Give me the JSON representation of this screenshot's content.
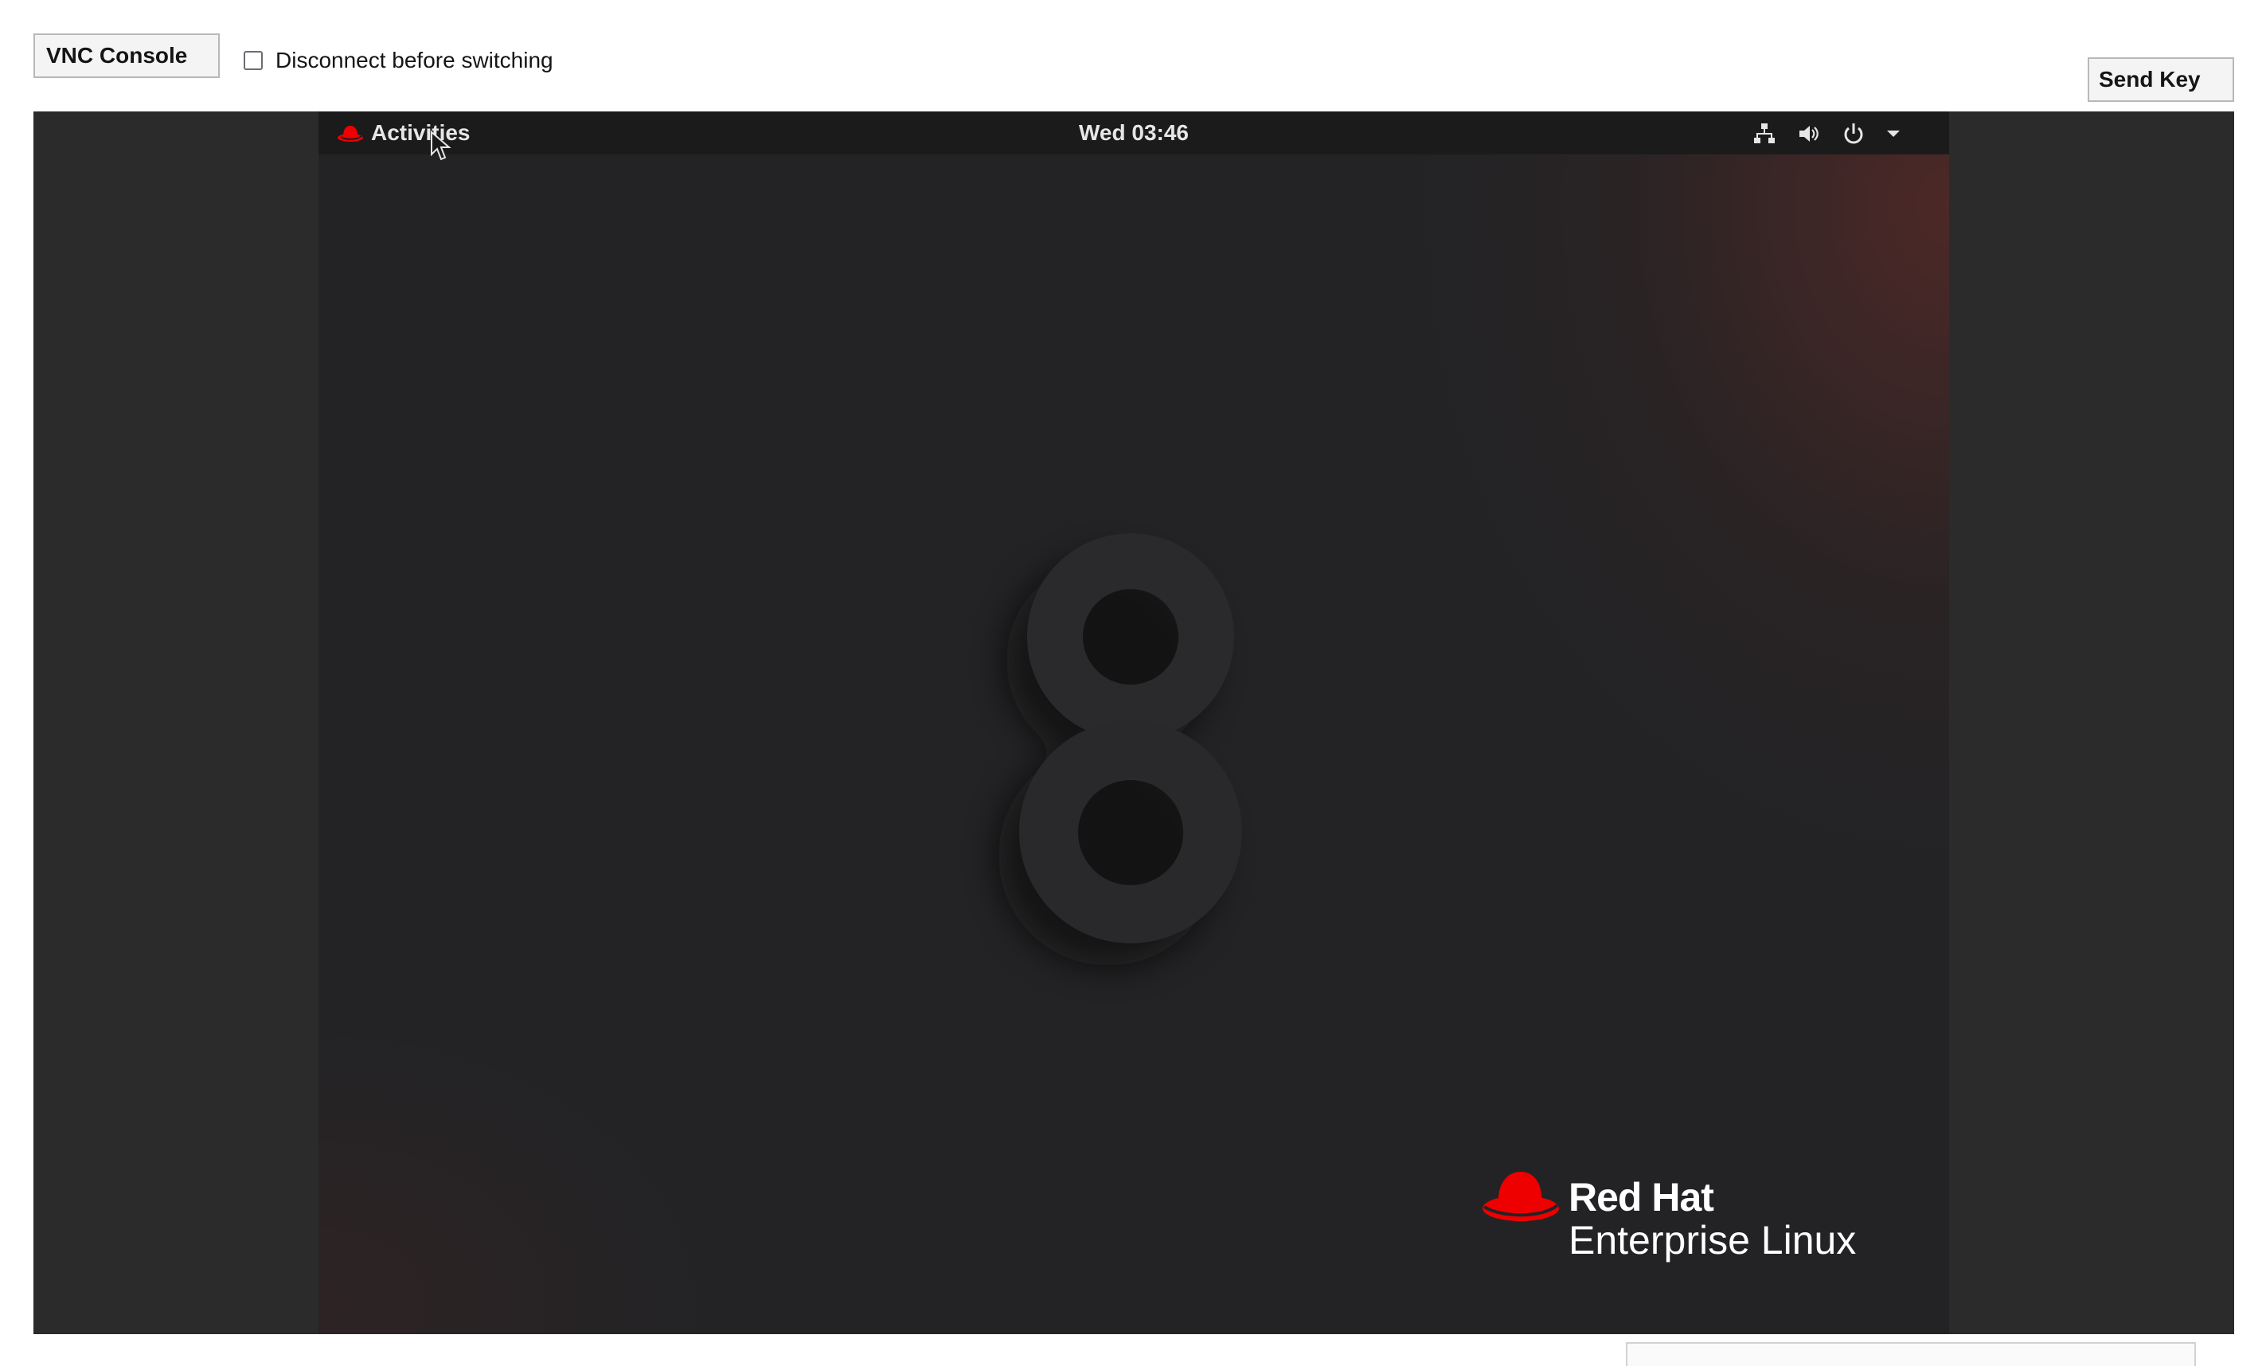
{
  "toolbar": {
    "console_type_label": "VNC Console",
    "disconnect_label": "Disconnect before switching",
    "disconnect_checked": false,
    "send_key_label": "Send Key"
  },
  "vm_screen": {
    "topbar": {
      "activities_label": "Activities",
      "clock": "Wed 03:46",
      "tray_icons": [
        "network-icon",
        "volume-icon",
        "power-icon",
        "chevron-down-icon"
      ]
    },
    "wallpaper": {
      "numeral_icon": "eight-numeral",
      "brand_line1": "Red Hat",
      "brand_line2": "Enterprise Linux",
      "brand_color": "#ee0000"
    }
  }
}
